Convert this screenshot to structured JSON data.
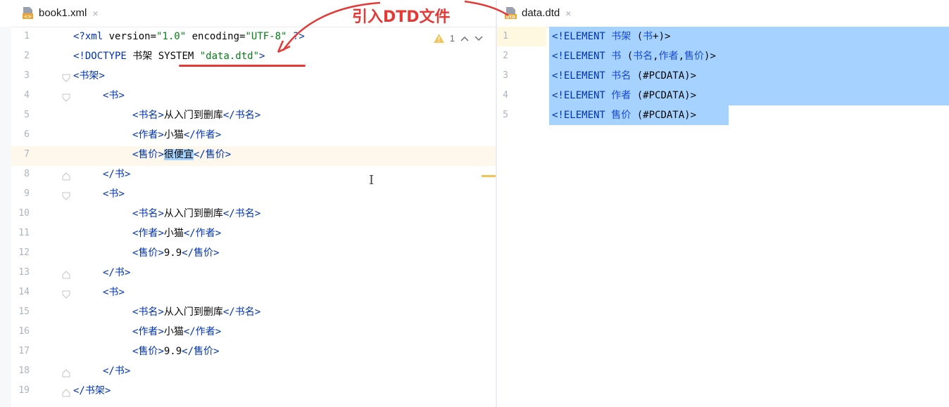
{
  "annotation": {
    "text": "引入DTD文件",
    "color": "#e53935"
  },
  "left": {
    "tab": {
      "label": "book1.xml",
      "close": "×"
    },
    "inspections": {
      "warning_count": "1",
      "up": "^",
      "down": "v"
    },
    "lines": [
      {
        "n": "1",
        "code": "<?xml version=\"1.0\" encoding=\"UTF-8\" ?>"
      },
      {
        "n": "2",
        "code": "<!DOCTYPE 书架 SYSTEM \"data.dtd\">"
      },
      {
        "n": "3",
        "code": "<书架>"
      },
      {
        "n": "4",
        "code": "<书>"
      },
      {
        "n": "5",
        "code": "<书名>从入门到删库</书名>"
      },
      {
        "n": "6",
        "code": "<作者>小猫</作者>"
      },
      {
        "n": "7",
        "code": "<售价>很便宜</售价>"
      },
      {
        "n": "8",
        "code": "</书>"
      },
      {
        "n": "9",
        "code": "<书>"
      },
      {
        "n": "10",
        "code": "<书名>从入门到删库</书名>"
      },
      {
        "n": "11",
        "code": "<作者>小猫</作者>"
      },
      {
        "n": "12",
        "code": "<售价>9.9</售价>"
      },
      {
        "n": "13",
        "code": "</书>"
      },
      {
        "n": "14",
        "code": "<书>"
      },
      {
        "n": "15",
        "code": "<书名>从入门到删库</书名>"
      },
      {
        "n": "16",
        "code": "<作者>小猫</作者>"
      },
      {
        "n": "17",
        "code": "<售价>9.9</售价>"
      },
      {
        "n": "18",
        "code": "</书>"
      },
      {
        "n": "19",
        "code": "</书架>"
      }
    ],
    "selected_text": "很便宜"
  },
  "right": {
    "tab": {
      "label": "data.dtd",
      "close": "×",
      "icon_text": "DTD"
    },
    "lines": [
      {
        "n": "1",
        "code": "<!ELEMENT 书架 (书+)>"
      },
      {
        "n": "2",
        "code": "<!ELEMENT 书 (书名,作者,售价)>"
      },
      {
        "n": "3",
        "code": "<!ELEMENT 书名 (#PCDATA)>"
      },
      {
        "n": "4",
        "code": "<!ELEMENT 作者 (#PCDATA)>"
      },
      {
        "n": "5",
        "code": "<!ELEMENT 售价 (#PCDATA)>"
      }
    ]
  },
  "colors": {
    "tag": "#0033b3",
    "attr": "#174ad4",
    "string": "#067d17",
    "selection": "#a6d2ff",
    "caret_line": "#fdf8eb"
  }
}
